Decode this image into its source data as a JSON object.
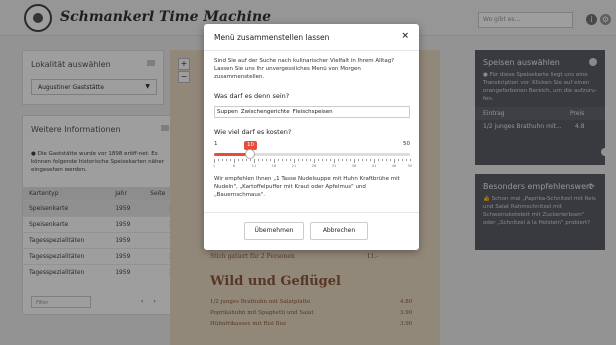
{
  "app": {
    "title": "Schmankerl Time Machine"
  },
  "header": {
    "search_placeholder": "Wo gibt es...",
    "icon1": "info-icon",
    "icon2": "settings-icon"
  },
  "left": {
    "location_title": "Lokalität auswählen",
    "location_value": "Augustiner Gaststätte",
    "info_title": "Weitere Informationen",
    "info_text": "Die Gaststätte wurde vor 1898 eröff-net. Es können folgende historische Speisekarten näher eingesehen werden.",
    "table": {
      "headers": [
        "Kartentyp",
        "Jahr",
        "Seite"
      ],
      "rows": [
        [
          "Speisenkarte",
          "1959",
          "2"
        ],
        [
          "Speisenkarte",
          "1959",
          "3"
        ],
        [
          "Tagesspezialitäten",
          "1959",
          "1"
        ],
        [
          "Tagesspezialitäten",
          "1959",
          "2"
        ],
        [
          "Tagesspezialitäten",
          "1959",
          "3"
        ]
      ]
    },
    "filter_placeholder": "Filter",
    "pager_prev": "‹",
    "pager_next": "›"
  },
  "menu": {
    "zoom_in": "+",
    "zoom_out": "−",
    "heading": "Wild und Geflügel",
    "line_above": "Stich gatiert für 2 Personen",
    "line_above_price": "11.-",
    "items": [
      {
        "name": "1/2 junges Brathuhn mit Salatplatte",
        "price": "4.80"
      },
      {
        "name": "Poprikahuhn mit Spaghetti und Salat",
        "price": "3.90"
      },
      {
        "name": "Hühnfrikassee mit Risi Bisi",
        "price": "3.90"
      }
    ]
  },
  "right": {
    "dishes": {
      "title": "Speisen auswählen",
      "info": "Für diese Speisekarte liegt uns eine Transkription vor. Klicken Sie auf einen orangefarbenen Bereich, um die aufzuru-fen.",
      "col_item": "Eintrag",
      "col_price": "Preis",
      "row_item": "1/2 junges Brathuhn mit...",
      "row_price": "4.8"
    },
    "recommend": {
      "title": "Besonders empfehlenswert",
      "text": "Schon mal „Paprika-Schnitzel mit Reis und Salat Rahmschnitzel mit Schweinskotelett mit Zuckerlerbsen\" oder „Schnitzel à la Holstein\" probiert?"
    }
  },
  "modal": {
    "title": "Menü zusammenstellen lassen",
    "close": "×",
    "intro": "Sind Sie auf der Suche nach kulinarischer Vielfalt in Ihrem Alltag? Lassen Sie uns Ihr unvergessliches Menü von Morgen zusammenstellen.",
    "q1": "Was darf es denn sein?",
    "tags": [
      "Suppen",
      "Zwischengerichte",
      "Fleischspeisen"
    ],
    "q2": "Wie viel darf es kosten?",
    "slider": {
      "min": 1,
      "max": 50,
      "value": 10,
      "ticks": [
        "1",
        "6",
        "11",
        "16",
        "21",
        "26",
        "31",
        "36",
        "41",
        "46",
        "50"
      ]
    },
    "recommendation": "Wir empfehlen Ihnen „1 Tasse Nudelsuppe mit Huhn Kraftbrühe mit Nudeln\", „Kartoffelpuffer mit Kraut oder Apfelmus\" und „Bauernschmaus\".",
    "ok": "Übernehmen",
    "cancel": "Abbrechen"
  }
}
